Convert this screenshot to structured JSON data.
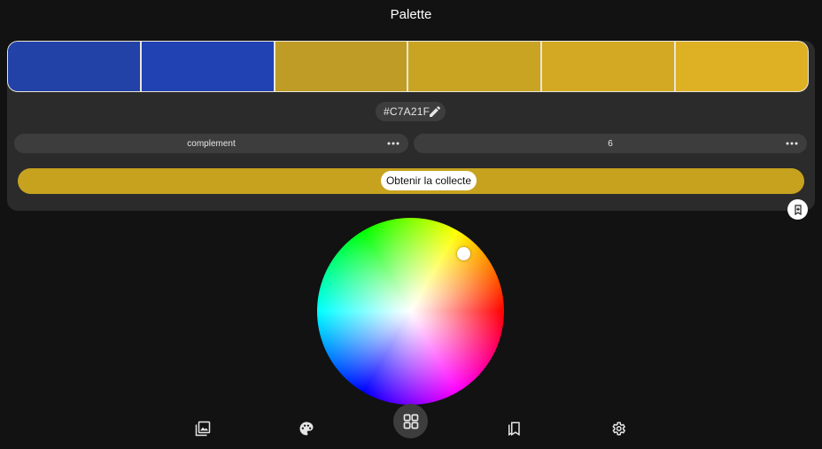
{
  "app": {
    "title": "Palette"
  },
  "palette": {
    "swatches": [
      {
        "color": "#2342a8"
      },
      {
        "color": "#2142b2"
      },
      {
        "color": "#bf9c26"
      },
      {
        "color": "#c9a423"
      },
      {
        "color": "#d3a923"
      },
      {
        "color": "#deb024"
      }
    ],
    "selected_hex": "#C7A21F"
  },
  "controls": {
    "scheme_value": "complement",
    "count_value": "6",
    "get_button_label": "Obtenir la collecte",
    "accent_color": "#c6a21f"
  },
  "icons": {
    "edit": "pencil-icon",
    "more": "more-horizontal-icon",
    "save": "bookmark-add-icon"
  },
  "nav": {
    "items": [
      {
        "name": "gallery",
        "icon": "image-gallery-icon"
      },
      {
        "name": "palette",
        "icon": "palette-icon"
      },
      {
        "name": "grid",
        "icon": "grid-icon",
        "active": true
      },
      {
        "name": "saved",
        "icon": "bookmarks-icon"
      },
      {
        "name": "settings",
        "icon": "gear-icon"
      }
    ]
  }
}
